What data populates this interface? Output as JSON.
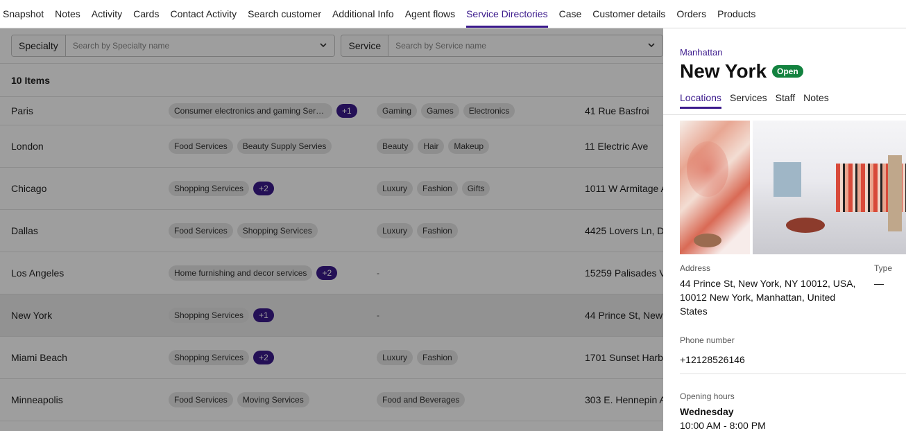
{
  "nav": {
    "tabs": [
      "Snapshot",
      "Notes",
      "Activity",
      "Cards",
      "Contact Activity",
      "Search customer",
      "Additional Info",
      "Agent flows",
      "Service Directories",
      "Case",
      "Customer details",
      "Orders",
      "Products"
    ],
    "active": "Service Directories"
  },
  "filters": {
    "specialty_label": "Specialty",
    "specialty_placeholder": "Search by Specialty name",
    "service_label": "Service",
    "service_placeholder": "Search by Service name"
  },
  "list": {
    "count": "10 Items",
    "rows": [
      {
        "city": "Paris",
        "specialties": [
          "Consumer electronics and gaming Servi..."
        ],
        "more": "+1",
        "tags": [
          "Gaming",
          "Games",
          "Electronics"
        ],
        "address": "41 Rue Basfroi"
      },
      {
        "city": "London",
        "specialties": [
          "Food Services",
          "Beauty Supply Servies"
        ],
        "more": "",
        "tags": [
          "Beauty",
          "Hair",
          "Makeup"
        ],
        "address": "11 Electric Ave"
      },
      {
        "city": "Chicago",
        "specialties": [
          "Shopping Services"
        ],
        "more": "+2",
        "tags": [
          "Luxury",
          "Fashion",
          "Gifts"
        ],
        "address": "1011 W Armitage A"
      },
      {
        "city": "Dallas",
        "specialties": [
          "Food Services",
          "Shopping Services"
        ],
        "more": "",
        "tags": [
          "Luxury",
          "Fashion"
        ],
        "address": "4425 Lovers Ln, Da"
      },
      {
        "city": "Los Angeles",
        "specialties": [
          "Home furnishing and decor services"
        ],
        "more": "+2",
        "tags": [],
        "address": "15259 Palisades V"
      },
      {
        "city": "New York",
        "specialties": [
          "Shopping Services"
        ],
        "more": "+1",
        "tags": [],
        "address": "44 Prince St, New"
      },
      {
        "city": "Miami Beach",
        "specialties": [
          "Shopping Services"
        ],
        "more": "+2",
        "tags": [
          "Luxury",
          "Fashion"
        ],
        "address": "1701 Sunset Harb"
      },
      {
        "city": "Minneapolis",
        "specialties": [
          "Food Services",
          "Moving Services"
        ],
        "more": "",
        "tags": [
          "Food and Beverages"
        ],
        "address": "303 E. Hennepin A"
      }
    ],
    "selected_index": 5,
    "empty_tag": "-"
  },
  "panel": {
    "area": "Manhattan",
    "title": "New York",
    "status": "Open",
    "tabs": [
      "Locations",
      "Services",
      "Staff",
      "Notes"
    ],
    "active_tab": "Locations",
    "address_label": "Address",
    "address": "44 Prince St, New York, NY 10012, USA, 10012 New York, Manhattan, United States",
    "type_label": "Type",
    "type_value": "—",
    "phone_label": "Phone number",
    "phone": "+12128526146",
    "hours_label": "Opening hours",
    "hours_day": "Wednesday",
    "hours_time": "10:00 AM - 8:00 PM"
  },
  "colors": {
    "accent": "#3b1a8c",
    "status_open": "#13823f",
    "overlay": "rgba(0,0,0,0.38)"
  }
}
